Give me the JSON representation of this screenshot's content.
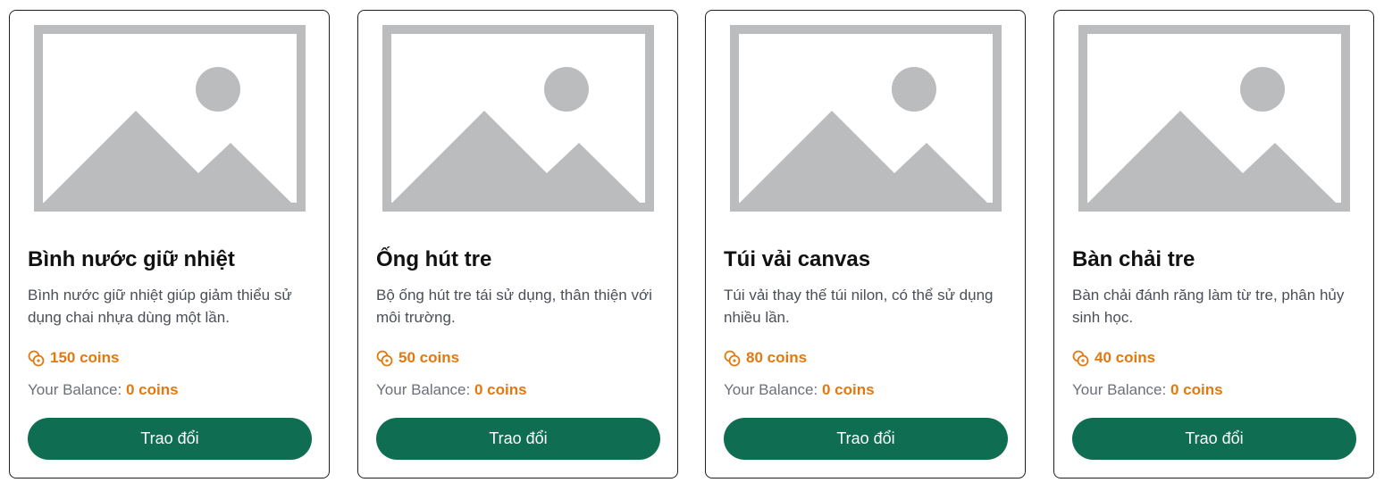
{
  "balance_label": "Your Balance:",
  "colors": {
    "accent": "#e07a10",
    "button": "#0f6e51",
    "placeholder": "#bbbcbe"
  },
  "products": [
    {
      "title": "Bình nước giữ nhiệt",
      "description": "Bình nước giữ nhiệt giúp giảm thiểu sử dụng chai nhựa dùng một lần.",
      "price": "150 coins",
      "balance": "0 coins",
      "button_label": "Trao đổi",
      "image_icon": "image-placeholder-icon",
      "price_icon": "coins-icon"
    },
    {
      "title": "Ống hút tre",
      "description": "Bộ ống hút tre tái sử dụng, thân thiện với môi trường.",
      "price": "50 coins",
      "balance": "0 coins",
      "button_label": "Trao đổi",
      "image_icon": "image-placeholder-icon",
      "price_icon": "coins-icon"
    },
    {
      "title": "Túi vải canvas",
      "description": "Túi vải thay thế túi nilon, có thể sử dụng nhiều lần.",
      "price": "80 coins",
      "balance": "0 coins",
      "button_label": "Trao đổi",
      "image_icon": "image-placeholder-icon",
      "price_icon": "coins-icon"
    },
    {
      "title": "Bàn chải tre",
      "description": "Bàn chải đánh răng làm từ tre, phân hủy sinh học.",
      "price": "40 coins",
      "balance": "0 coins",
      "button_label": "Trao đổi",
      "image_icon": "image-placeholder-icon",
      "price_icon": "coins-icon"
    }
  ]
}
